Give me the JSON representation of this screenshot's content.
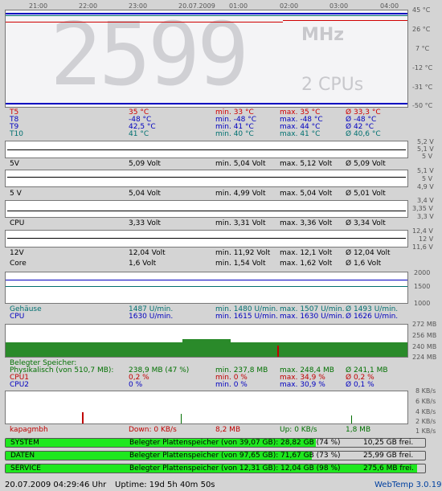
{
  "time_axis": [
    "21:00",
    "22:00",
    "23:00",
    "20.07.2009",
    "01:00",
    "02:00",
    "03:00",
    "04:00"
  ],
  "temp": {
    "axis": [
      "45 °C",
      "26 °C",
      "7 °C",
      "-12 °C",
      "-31 °C",
      "-50 °C"
    ],
    "big_value": "2599",
    "big_unit": "MHz",
    "big_cpus": "2 CPUs",
    "rows": [
      {
        "name": "T5",
        "val": "35 °C",
        "min": "min. 33 °C",
        "max": "max. 35 °C",
        "avg": "Ø 33,3 °C",
        "color": "#d00000"
      },
      {
        "name": "T8",
        "val": "-48 °C",
        "min": "min. -48 °C",
        "max": "max. -48 °C",
        "avg": "Ø -48 °C",
        "color": "#0000c0"
      },
      {
        "name": "T9",
        "val": "42,5 °C",
        "min": "min. 41 °C",
        "max": "max. 44 °C",
        "avg": "Ø 42 °C",
        "color": "#0000c0"
      },
      {
        "name": "T10",
        "val": "41 °C",
        "min": "min. 40 °C",
        "max": "max. 41 °C",
        "avg": "Ø 40,6 °C",
        "color": "#007070"
      }
    ]
  },
  "volt": [
    {
      "axis": [
        "5,2 V",
        "5,1 V",
        "5 V"
      ],
      "name": "5V",
      "val": "5,09 Volt",
      "min": "min. 5,04 Volt",
      "max": "max. 5,12 Volt",
      "avg": "Ø 5,09 Volt"
    },
    {
      "axis": [
        "5,1 V",
        "5 V",
        "4,9 V"
      ],
      "name": "5 V",
      "val": "5,04 Volt",
      "min": "min. 4,99 Volt",
      "max": "max. 5,04 Volt",
      "avg": "Ø 5,01 Volt"
    },
    {
      "axis": [
        "3,4 V",
        "3,35 V",
        "3,3 V"
      ],
      "name": "CPU",
      "val": "3,33 Volt",
      "min": "min. 3,31 Volt",
      "max": "max. 3,36 Volt",
      "avg": "Ø 3,34 Volt"
    },
    {
      "axis": [
        "12,4 V",
        "12 V",
        "11,6 V"
      ],
      "name": "12V",
      "val": "12,04 Volt",
      "min": "min. 11,92 Volt",
      "max": "max. 12,1 Volt",
      "avg": "Ø 12,04 Volt"
    }
  ],
  "core": {
    "name": "Core",
    "val": "1,6 Volt",
    "min": "min. 1,54 Volt",
    "max": "max. 1,62 Volt",
    "avg": "Ø 1,6 Volt"
  },
  "fan": {
    "axis": [
      "2000",
      "1500",
      "1000"
    ],
    "rows": [
      {
        "name": "Gehäuse",
        "val": "1487 U/min.",
        "min": "min. 1480 U/min.",
        "max": "max. 1507 U/min.",
        "avg": "Ø 1493 U/min.",
        "color": "#007070"
      },
      {
        "name": "CPU",
        "val": "1630 U/min.",
        "min": "min. 1615 U/min.",
        "max": "max. 1630 U/min.",
        "avg": "Ø 1626 U/min.",
        "color": "#0000c0"
      }
    ]
  },
  "mem": {
    "axis": [
      "272 MB",
      "256 MB",
      "240 MB",
      "224 MB"
    ],
    "header": "Belegter Speicher:",
    "rows": [
      {
        "name": "Physikalisch (von 510,7 MB):",
        "val": "238,9 MB (47 %)",
        "min": "min. 237,8 MB",
        "max": "max. 248,4 MB",
        "avg": "Ø 241,1 MB",
        "color": "#007000"
      },
      {
        "name": "CPU1",
        "val": "0,2 %",
        "min": "min. 0 %",
        "max": "max. 34,9 %",
        "avg": "Ø 0,2 %",
        "color": "#c00000"
      },
      {
        "name": "CPU2",
        "val": "0 %",
        "min": "min. 0 %",
        "max": "max. 30,9 %",
        "avg": "Ø 0,1 %",
        "color": "#0000c0"
      }
    ]
  },
  "net": {
    "axis": [
      "8 KB/s",
      "6 KB/s",
      "4 KB/s",
      "2 KB/s",
      "1 KB/s"
    ],
    "name": "kapagmbh",
    "down": "Down: 0 KB/s",
    "down_total": "8,2 MB",
    "up": "Up: 0 KB/s",
    "up_total": "1,8 MB"
  },
  "disks": [
    {
      "name": "SYSTEM",
      "label": "Belegter Plattenspeicher (von 39,07 GB):",
      "used": "28,82 GB (74 %)",
      "free": "10,25 GB frei.",
      "pct": 0.74
    },
    {
      "name": "DATEN",
      "label": "Belegter Plattenspeicher (von 97,65 GB):",
      "used": "71,67 GB (73 %)",
      "free": "25,99 GB frei.",
      "pct": 0.73
    },
    {
      "name": "SERVICE",
      "label": "Belegter Plattenspeicher (von 12,31 GB):",
      "used": "12,04 GB (98 %)",
      "free": "275,6 MB frei.",
      "pct": 0.98
    }
  ],
  "footer": {
    "datetime": "20.07.2009 04:29:46 Uhr",
    "uptime": "Uptime: 19d 5h 40m 50s",
    "version": "WebTemp 3.0.19"
  }
}
